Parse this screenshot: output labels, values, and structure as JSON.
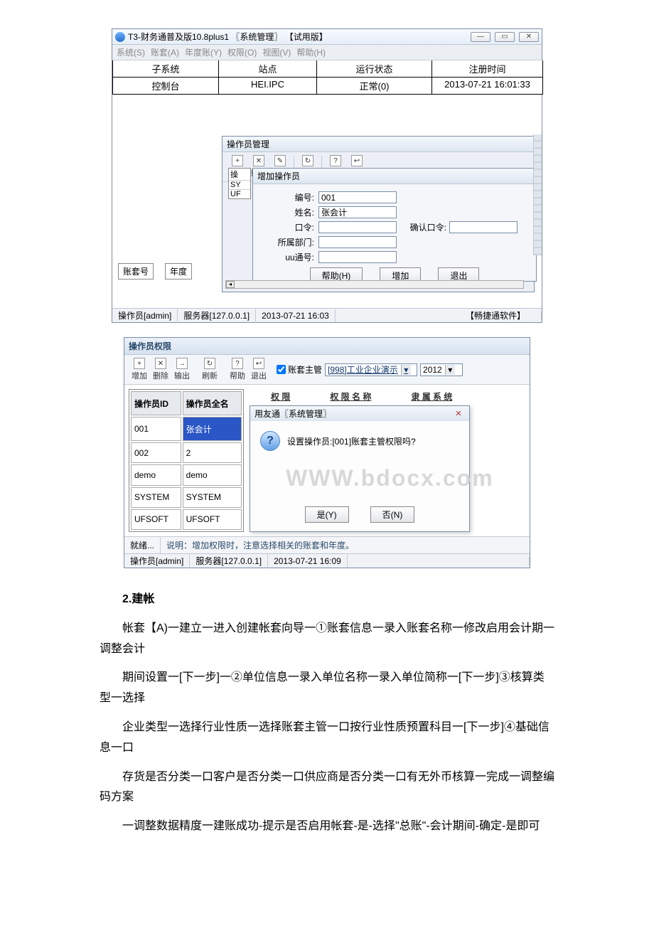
{
  "win1": {
    "title": "T3-财务通普及版10.8plus1 〖系统管理〗 【试用版】",
    "menus": [
      "系统(S)",
      "账套(A)",
      "年度账(Y)",
      "权限(O)",
      "视图(V)",
      "帮助(H)"
    ],
    "gridHead": [
      "子系统",
      "站点",
      "运行状态",
      "注册时间"
    ],
    "gridRow": [
      "控制台",
      "HEI.IPC",
      "正常(0)",
      "2013-07-21 16:01:33"
    ],
    "panelLabels": {
      "acct": "账套号",
      "year": "年度"
    },
    "innerTitle": "操作员管理",
    "toolbar": {
      "add": "增加",
      "del": "删除",
      "mod": "修改",
      "refresh": "刷新",
      "help": "帮助",
      "exit": "退出",
      "addI": "+",
      "delI": "✕",
      "modI": "✎",
      "refI": "↻",
      "hlpI": "?",
      "extI": "↩"
    },
    "miniRows": [
      "操",
      "SY",
      "UF"
    ],
    "addDlg": {
      "title": "增加操作员",
      "fields": {
        "id": "编号:",
        "name": "姓名:",
        "pwd": "口令:",
        "pwd2": "确认口令:",
        "dept": "所属部门:",
        "uu": "uu通号:"
      },
      "values": {
        "id": "001",
        "name": "张会计"
      },
      "buttons": {
        "help": "帮助(H)",
        "add": "增加",
        "exit": "退出"
      }
    },
    "status": {
      "op": "操作员[admin]",
      "srv": "服务器[127.0.0.1]",
      "time": "2013-07-21 16:03",
      "brand": "【畅捷通软件】"
    }
  },
  "win2": {
    "title": "操作员权限",
    "toolbar": {
      "add": "增加",
      "del": "删除",
      "out": "输出",
      "refresh": "刷新",
      "help": "帮助",
      "exit": "退出",
      "addI": "+",
      "delI": "✕",
      "outI": "→",
      "refI": "↻",
      "hlpI": "?",
      "extI": "↩"
    },
    "chk": "账套主管",
    "combo1": "[998]工业企业演示",
    "combo2": "2012",
    "tblHead": [
      "操作员ID",
      "操作员全名"
    ],
    "tblRows": [
      [
        "001",
        "张会计"
      ],
      [
        "002",
        "2"
      ],
      [
        "demo",
        "demo"
      ],
      [
        "SYSTEM",
        "SYSTEM"
      ],
      [
        "UFSOFT",
        "UFSOFT"
      ]
    ],
    "rHeaders": [
      "权 限",
      "权 限 名 称",
      "隶 属 系 统"
    ],
    "msg": {
      "title": "用友通〖系统管理〗",
      "text": "设置操作员:[001]账套主管权限吗?",
      "yes": "是(Y)",
      "no": "否(N)"
    },
    "watermark": "WWW.bdocx.com",
    "footL": "就绪...",
    "footR": "说明：增加权限时，注意选择相关的账套和年度。",
    "status": {
      "op": "操作员[admin]",
      "srv": "服务器[127.0.0.1]",
      "time": "2013-07-21 16:09"
    }
  },
  "article": {
    "h": "2.建帐",
    "p1": "帐套【A)一建立一进入创建帐套向导一①账套信息一录入账套名称一修改启用会计期一调整会计",
    "p2": "期间设置一[下一步]一②单位信息一录入单位名称一录入单位简称一[下一步]③核算类型一选择",
    "p3": "企业类型一选择行业性质一选择账套主管一口按行业性质预置科目一[下一步]④基础信息一口",
    "p4": "存货是否分类一口客户是否分类一口供应商是否分类一口有无外币核算一完成一调整编码方案",
    "p5": "一调整数据精度一建账成功-提示是否启用帐套-是-选择\"总账\"-会计期间-确定-是即可"
  }
}
